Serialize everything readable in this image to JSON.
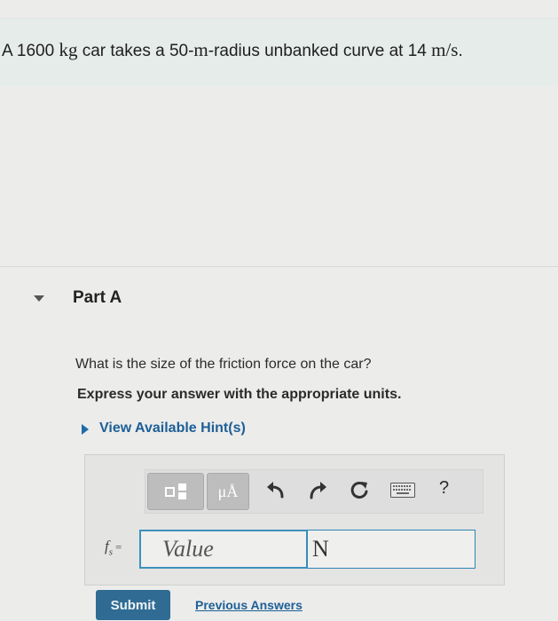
{
  "problem": {
    "prefix": "A 1600",
    "mass_unit": "kg",
    "middle": "car takes a 50-",
    "m": "m",
    "radius_text": "-radius unbanked curve at 14",
    "speed_unit": "m/s",
    "period": "."
  },
  "part": {
    "title": "Part A"
  },
  "question": {
    "text": "What is the size of the friction force on the car?",
    "instruction": "Express your answer with the appropriate units.",
    "hint_link": "View Available Hint(s)"
  },
  "toolbar": {
    "units_label": "μÅ",
    "help_label": "?",
    "icons": [
      "templates-icon",
      "undo-icon",
      "redo-icon",
      "reset-icon",
      "keyboard-icon",
      "help-icon"
    ]
  },
  "answer": {
    "variable": "f",
    "subscript": "s",
    "equals": "=",
    "value_placeholder": "Value",
    "unit_value": "N"
  },
  "actions": {
    "submit_label": "Submit",
    "previous_answers_label": "Previous Answers"
  },
  "colors": {
    "link": "#1d5f96",
    "submit_bg": "#2f6b93",
    "input_border": "#3d90bd",
    "problem_bar_bg": "#e6ece9"
  }
}
